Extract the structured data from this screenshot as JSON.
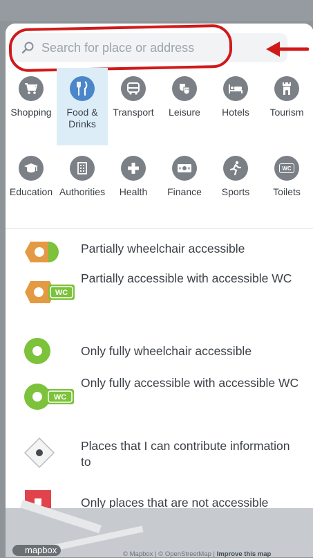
{
  "search": {
    "placeholder": "Search for place or address"
  },
  "categories": [
    {
      "label": "Shopping",
      "icon": "shopping-cart-icon"
    },
    {
      "label": "Food &\nDrinks",
      "icon": "fork-knife-icon"
    },
    {
      "label": "Transport",
      "icon": "bus-icon"
    },
    {
      "label": "Leisure",
      "icon": "theater-masks-icon"
    },
    {
      "label": "Hotels",
      "icon": "bed-icon"
    },
    {
      "label": "Tourism",
      "icon": "landmark-tower-icon"
    },
    {
      "label": "Education",
      "icon": "graduation-cap-icon"
    },
    {
      "label": "Authorities",
      "icon": "building-icon"
    },
    {
      "label": "Health",
      "icon": "plus-cross-icon"
    },
    {
      "label": "Finance",
      "icon": "banknote-icon"
    },
    {
      "label": "Sports",
      "icon": "running-person-icon"
    },
    {
      "label": "Toilets",
      "icon": "wc-icon"
    }
  ],
  "icon_texts": {
    "wc_badge": "WC"
  },
  "legend": [
    {
      "label": "Partially wheelchair accessible",
      "icon": "partial-accessible-marker-icon"
    },
    {
      "label": "Partially accessible with accessible WC",
      "icon": "partial-accessible-wc-marker-icon"
    },
    {
      "label": "Only fully wheelchair accessible",
      "icon": "full-accessible-marker-icon"
    },
    {
      "label": "Only fully accessible with accessible WC",
      "icon": "full-accessible-wc-marker-icon"
    },
    {
      "label": "Places that I can contribute information to",
      "icon": "contribute-diamond-icon"
    },
    {
      "label": "Only places that are not accessible",
      "icon": "not-accessible-square-icon"
    }
  ],
  "footer": {
    "logo": "mapbox",
    "attribution_prefix": "© Mapbox | © OpenStreetMap | ",
    "improve_link": "Improve this map"
  },
  "colors": {
    "accent": "#4a86c8",
    "selected_bg": "#dcedf8",
    "partial": "#e39a43",
    "full": "#7cc23a",
    "not_accessible": "#e0434b",
    "annotation": "#d01a1a"
  }
}
